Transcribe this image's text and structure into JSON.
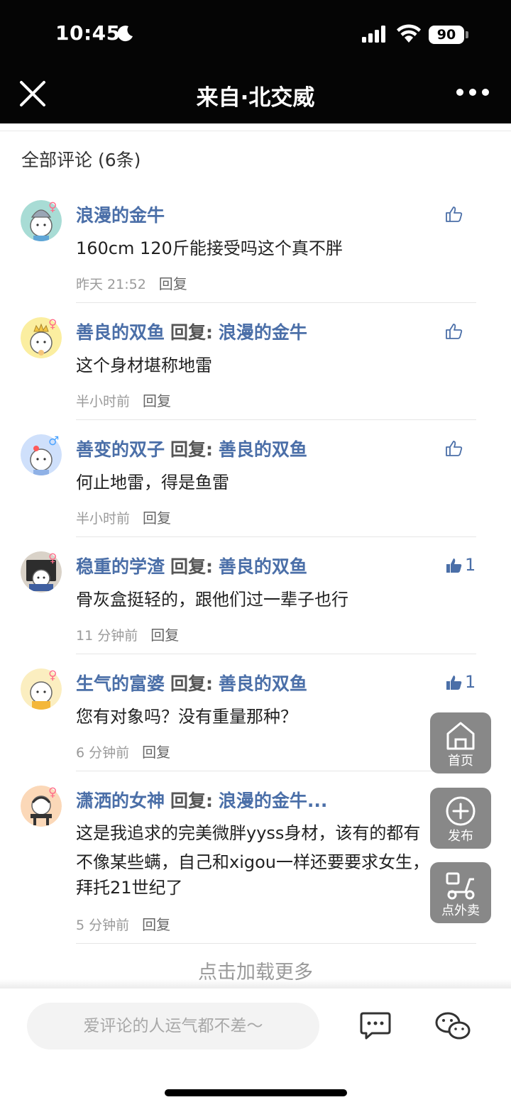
{
  "status_bar": {
    "time": "10:45",
    "battery": "90"
  },
  "nav": {
    "title": "来自·北交威"
  },
  "section": {
    "title": "全部评论 (6条)"
  },
  "comments": [
    {
      "name": "浪漫的金牛",
      "reply_word": "",
      "reply_to": "",
      "text": "160cm 120斤能接受吗这个真不胖",
      "time": "昨天 21:52",
      "reply_label": "回复",
      "likes": "",
      "liked": false,
      "gender": "♀"
    },
    {
      "name": "善良的双鱼",
      "reply_word": "回复:",
      "reply_to": "浪漫的金牛",
      "text": "这个身材堪称地雷",
      "time": "半小时前",
      "reply_label": "回复",
      "likes": "",
      "liked": false,
      "gender": "♀"
    },
    {
      "name": "善变的双子",
      "reply_word": "回复:",
      "reply_to": "善良的双鱼",
      "text": "何止地雷，得是鱼雷",
      "time": "半小时前",
      "reply_label": "回复",
      "likes": "",
      "liked": false,
      "gender": "♂"
    },
    {
      "name": "稳重的学渣",
      "reply_word": "回复:",
      "reply_to": "善良的双鱼",
      "text": "骨灰盒挺轻的，跟他们过一辈子也行",
      "time": "11 分钟前",
      "reply_label": "回复",
      "likes": "1",
      "liked": true,
      "gender": "♀"
    },
    {
      "name": "生气的富婆",
      "reply_word": "回复:",
      "reply_to": "善良的双鱼",
      "text": "您有对象吗？没有重量那种？",
      "time": "6 分钟前",
      "reply_label": "回复",
      "likes": "1",
      "liked": true,
      "gender": "♀"
    },
    {
      "name": "潇洒的女神",
      "reply_word": "回复:",
      "reply_to": "浪漫的金牛...",
      "text_lines": [
        "这是我追求的完美微胖yyss身材，该有的都有",
        "不像某些螨，自己和xigou一样还要要求女生，",
        "拜托21世纪了"
      ],
      "time": "5 分钟前",
      "reply_label": "回复",
      "likes": "",
      "liked": false,
      "gender": "♀"
    }
  ],
  "load_more": "点击加载更多",
  "fabs": {
    "home": "首页",
    "post": "发布",
    "takeout": "点外卖"
  },
  "bottom": {
    "placeholder": "爱评论的人运气都不差～"
  },
  "colors": {
    "name": "#4b6fa8",
    "topbar": "#050505",
    "female": "#ff6d8a",
    "male": "#4aa3ff"
  }
}
